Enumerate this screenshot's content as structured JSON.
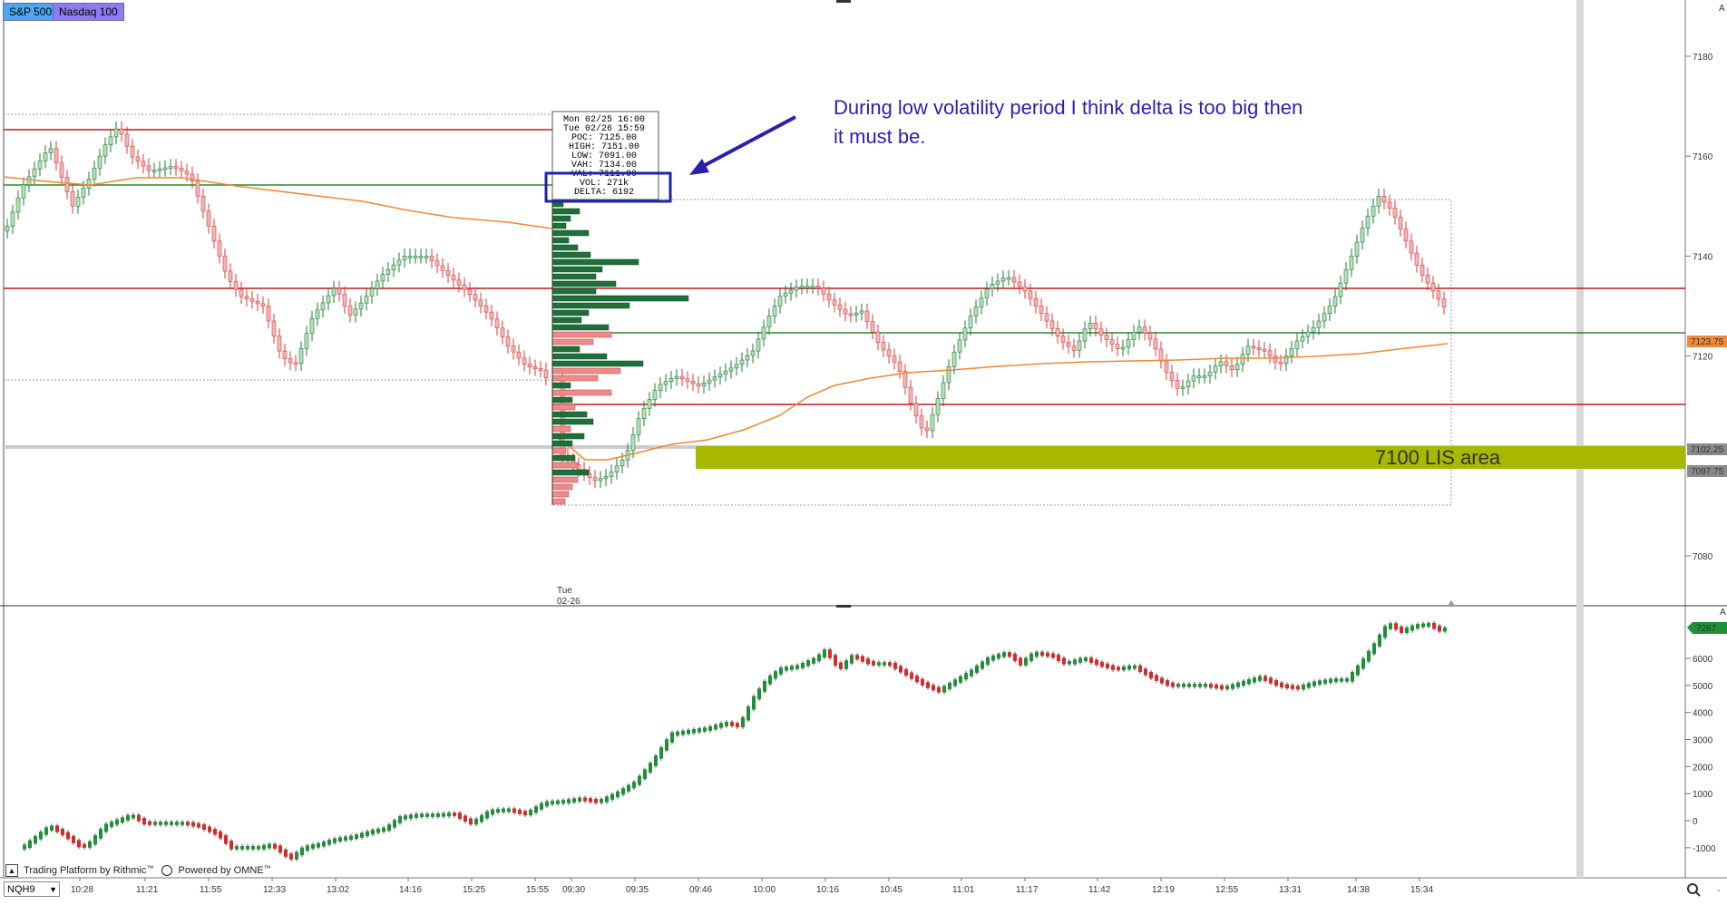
{
  "tabs": [
    {
      "label": "S&P 500",
      "active": true
    },
    {
      "label": "Nasdaq 100",
      "active": false
    }
  ],
  "annotation": {
    "line1": "During low volatility period I think delta is too big then",
    "line2": "it must be."
  },
  "lis_label": "7100 LIS area",
  "tooltip": {
    "rows": [
      "Mon 02/25 16:00",
      "Tue 02/26 15:59",
      "POC: 7125.00",
      "HIGH: 7151.00",
      "LOW: 7091.00",
      "VAH: 7134.00",
      "VAL: 7111.00",
      "VOL: 271k",
      "DELTA: 6192"
    ]
  },
  "price_axis": {
    "ticks": [
      "7180",
      "7160",
      "7140",
      "7120",
      "7080"
    ],
    "badges": [
      {
        "label": "7123.75",
        "color": "#f08a3c"
      },
      {
        "label": "7102.25",
        "color": "#8a8a8a"
      },
      {
        "label": "7097.75",
        "color": "#8a8a8a"
      }
    ]
  },
  "delta_axis": {
    "ticks": [
      "6000",
      "5000",
      "4000",
      "3000",
      "2000",
      "1000",
      "0",
      "-1000"
    ],
    "badge": {
      "label": "7267",
      "color": "#1f8f3a"
    }
  },
  "session_label": {
    "day": "Tue",
    "date": "02-26"
  },
  "time_axis": {
    "labels": [
      "10:28",
      "11:21",
      "11:55",
      "12:33",
      "13:02",
      "14:16",
      "15:25",
      "15:55",
      "09:30",
      "09:35",
      "09:46",
      "10:00",
      "10:16",
      "10:45",
      "11:01",
      "11:17",
      "11:42",
      "12:19",
      "12:55",
      "13:31",
      "14:38",
      "15:34"
    ]
  },
  "ticker": {
    "value": "NQH9"
  },
  "footer": {
    "brand": "Trading Platform by Rithmic",
    "tm": "™",
    "powered": "Powered by OMNE",
    "tm2": "™"
  },
  "corner_right": {
    "top": "A",
    "bottom": "-"
  },
  "colors": {
    "bull": "#1f7a3a",
    "bull_body": "#b8e0b8",
    "bear_body": "#f3b6b6",
    "bear": "#d93a3a",
    "red_line": "#c01818",
    "green_line": "#2a8a2a",
    "vwap": "#ee8833",
    "lis_band": "#a8b800",
    "annotation": "#2b1fb0"
  },
  "chart_data": [
    {
      "type": "candlestick",
      "title": "",
      "ylabel": "",
      "ylim": [
        7070,
        7190
      ],
      "levels": {
        "red_lines": [
          7165,
          7133,
          7111
        ],
        "green_lines": [
          7155,
          7125
        ],
        "vwap_last": 7123.75,
        "lis_band": [
          7097.75,
          7102.25
        ]
      },
      "volume_profile": {
        "poc": 7125,
        "high": 7151,
        "low": 7091,
        "vah": 7134,
        "val": 7111,
        "vol": "271k",
        "delta": 6192
      }
    },
    {
      "type": "line",
      "title": "",
      "ylabel": "",
      "ylim": [
        -1500,
        7000
      ],
      "last_value": 7267
    }
  ]
}
